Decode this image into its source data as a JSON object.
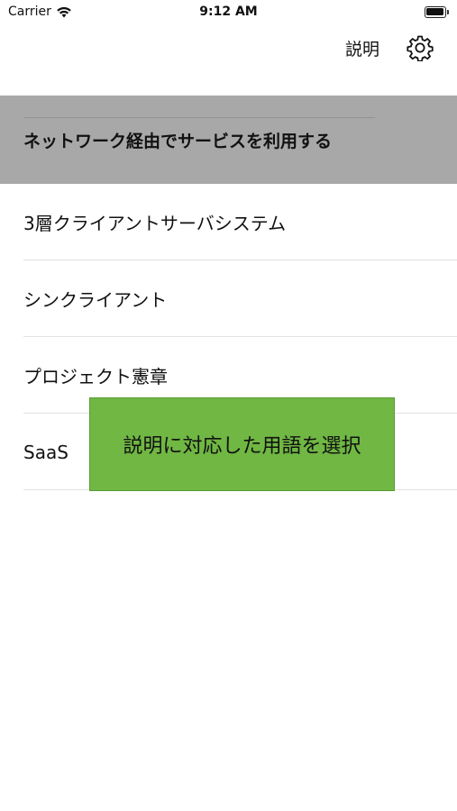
{
  "status_bar": {
    "carrier": "Carrier",
    "time": "9:12 AM"
  },
  "nav": {
    "explain_label": "説明",
    "settings_icon": "gear-icon"
  },
  "list": {
    "items": [
      {
        "label": "ネットワーク経由でサービスを利用する",
        "selected": true
      },
      {
        "label": "3層クライアントサーバシステム",
        "selected": false
      },
      {
        "label": "シンクライアント",
        "selected": false
      },
      {
        "label": "プロジェクト憲章",
        "selected": false
      },
      {
        "label": "SaaS",
        "selected": false
      }
    ]
  },
  "hint": {
    "text": "説明に対応した用語を選択"
  },
  "colors": {
    "selected_row_bg": "#a8a8a8",
    "hint_bg": "#70b743"
  }
}
